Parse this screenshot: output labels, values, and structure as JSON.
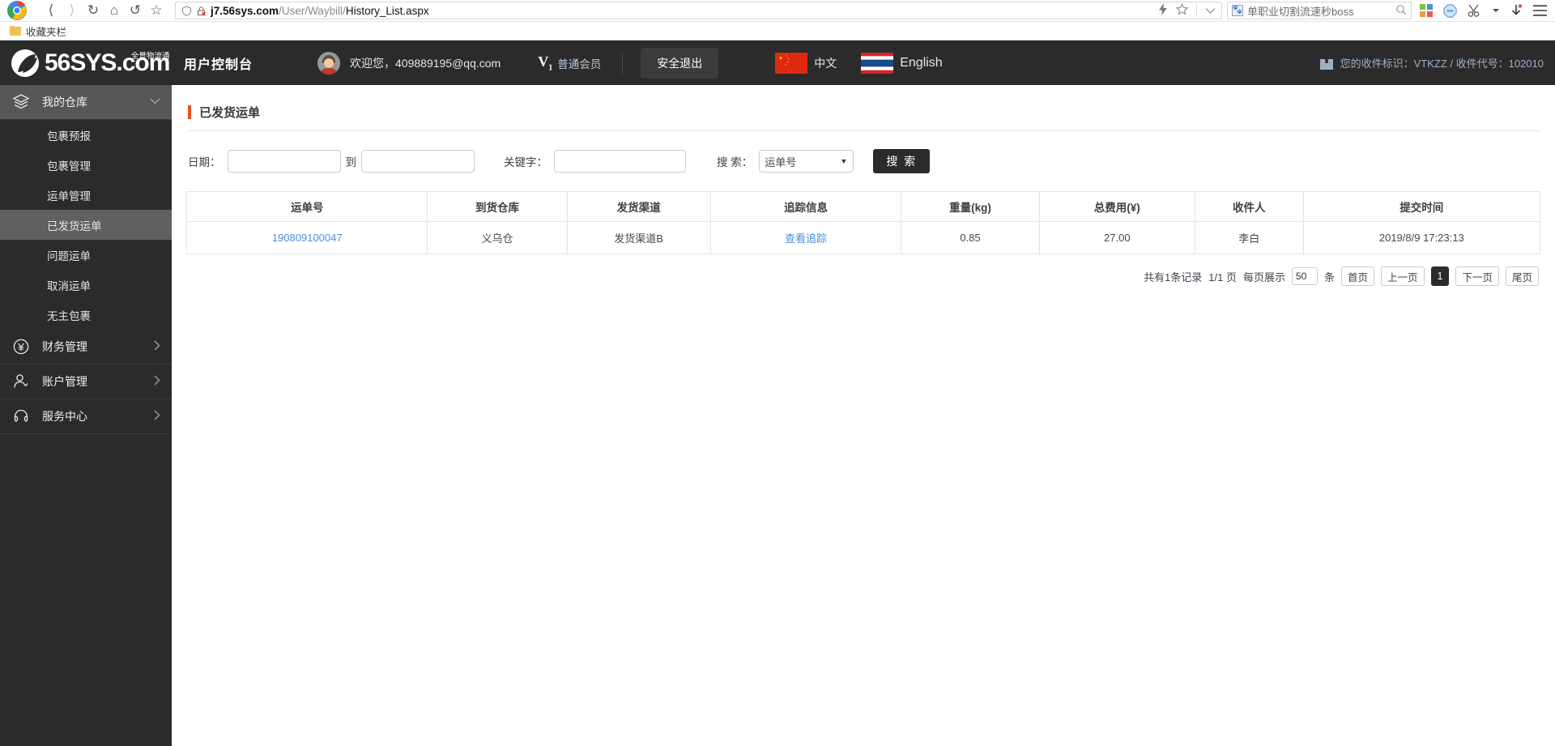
{
  "browser": {
    "nav": {
      "back_icon": "back-arrow-icon",
      "forward_icon": "forward-arrow-icon",
      "reload_icon": "reload-icon",
      "home_icon": "home-icon",
      "history_icon": "history-back-icon",
      "bookmark_icon": "star-icon"
    },
    "url": {
      "host": "j7.56sys.com",
      "path": "/User/Waybill/",
      "last": "History_List.aspx",
      "shield_icon": "shield-icon",
      "lock_icon": "lock-broken-icon"
    },
    "omni_right": {
      "lightning_icon": "lightning-icon",
      "star_icon": "star-outline-icon",
      "chevron_icon": "chevron-down-icon"
    },
    "search": {
      "value": "单职业切割流速秒boss",
      "placeholder": "搜索",
      "site_icon": "paw-favicon",
      "magnifier_icon": "search-icon"
    },
    "extensions": [
      {
        "name": "apps-grid-icon"
      },
      {
        "name": "adblock-icon"
      },
      {
        "name": "scissors-capture-icon"
      },
      {
        "name": "downloads-icon"
      },
      {
        "name": "menu-icon"
      }
    ],
    "bookmarks": {
      "folder_label": "收藏夹栏",
      "folder_icon": "folder-icon"
    }
  },
  "header": {
    "logo_text": "56SYS",
    "logo_domain": ".com",
    "logo_sub": "全景物流通",
    "console_title": "用户控制台",
    "avatar_icon": "user-avatar",
    "welcome": "欢迎您，409889195@qq.com",
    "vip_badge": "V",
    "vip_badge_sub": "1",
    "vip_label": "普通会员",
    "logout_label": "安全退出",
    "lang": [
      {
        "label": "中文",
        "flag": "china-flag-icon"
      },
      {
        "label": "English",
        "flag": "thailand-flag-icon"
      }
    ],
    "recv_icon": "box-icon",
    "recv_info": "您的收件标识：VTKZZ / 收件代号：102010"
  },
  "sidebar": {
    "groups": [
      {
        "label": "我的仓库",
        "icon": "layers-icon",
        "caret": "chevron-down-icon",
        "active": true,
        "expanded": true,
        "items": [
          {
            "label": "包裹预报",
            "active": false
          },
          {
            "label": "包裹管理",
            "active": false
          },
          {
            "label": "运单管理",
            "active": false
          },
          {
            "label": "已发货运单",
            "active": true
          },
          {
            "label": "问题运单",
            "active": false
          },
          {
            "label": "取消运单",
            "active": false
          },
          {
            "label": "无主包裹",
            "active": false
          }
        ]
      },
      {
        "label": "财务管理",
        "icon": "yen-circle-icon",
        "caret": "chevron-right-icon",
        "active": false,
        "expanded": false,
        "items": []
      },
      {
        "label": "账户管理",
        "icon": "user-icon",
        "caret": "chevron-right-icon",
        "active": false,
        "expanded": false,
        "items": []
      },
      {
        "label": "服务中心",
        "icon": "headset-icon",
        "caret": "chevron-right-icon",
        "active": false,
        "expanded": false,
        "items": []
      }
    ]
  },
  "main": {
    "page_title": "已发货运单",
    "filters": {
      "date_label": "日期：",
      "date_from_value": "",
      "date_from_placeholder": "",
      "to_label": "到",
      "date_to_value": "",
      "date_to_placeholder": "",
      "keyword_label": "关键字：",
      "keyword_value": "",
      "keyword_placeholder": "",
      "search_label": "搜 索：",
      "search_type_value": "运单号",
      "search_type_caret": "caret-down-icon",
      "search_button": "搜 索"
    },
    "table": {
      "columns": [
        "运单号",
        "到货仓库",
        "发货渠道",
        "追踪信息",
        "重量(kg)",
        "总费用(¥)",
        "收件人",
        "提交时间"
      ],
      "rows": [
        {
          "waybill_no": "190809100047",
          "warehouse": "义乌仓",
          "channel": "发货渠道B",
          "tracking": "查看追踪",
          "weight": "0.85",
          "fee": "27.00",
          "receiver": "李白",
          "submit_time": "2019/8/9 17:23:13"
        }
      ]
    },
    "pager": {
      "total_text": "共有1条记录",
      "page_text": "1/1 页",
      "per_page_label": "每页展示",
      "per_page_value": "50",
      "per_page_unit": "条",
      "first": "首页",
      "prev": "上一页",
      "current": "1",
      "next": "下一页",
      "last": "尾页"
    }
  },
  "colors": {
    "header_bg": "#2b2b2b",
    "sidebar_bg": "#2b2b2b",
    "sidebar_active": "#606060",
    "accent": "#e8521f",
    "link": "#4a90d9"
  }
}
